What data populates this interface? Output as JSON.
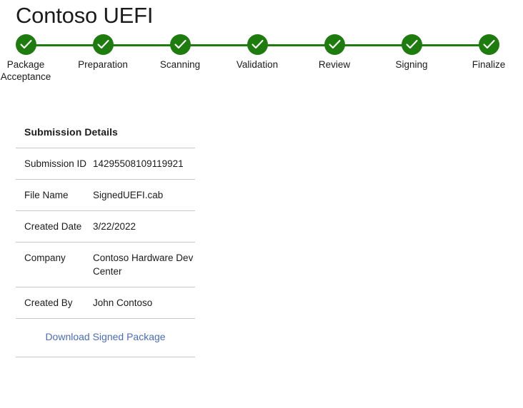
{
  "page": {
    "title": "Contoso UEFI"
  },
  "stepper": {
    "accent_color": "#1e7b0e",
    "steps": [
      {
        "label": "Package Acceptance",
        "icon": "check-icon",
        "state": "complete"
      },
      {
        "label": "Preparation",
        "icon": "check-icon",
        "state": "complete"
      },
      {
        "label": "Scanning",
        "icon": "check-icon",
        "state": "complete"
      },
      {
        "label": "Validation",
        "icon": "check-icon",
        "state": "complete"
      },
      {
        "label": "Review",
        "icon": "check-icon",
        "state": "complete"
      },
      {
        "label": "Signing",
        "icon": "check-icon",
        "state": "complete"
      },
      {
        "label": "Finalize",
        "icon": "check-icon",
        "state": "complete"
      }
    ]
  },
  "details": {
    "heading": "Submission Details",
    "rows": [
      {
        "key": "Submission ID",
        "value": "14295508109119921"
      },
      {
        "key": "File Name",
        "value": "SignedUEFI.cab"
      },
      {
        "key": "Created Date",
        "value": "3/22/2022"
      },
      {
        "key": "Company",
        "value": "Contoso Hardware Dev Center"
      },
      {
        "key": "Created By",
        "value": "John Contoso"
      }
    ],
    "download_label": "Download Signed Package",
    "link_color": "#4a6bbd"
  }
}
